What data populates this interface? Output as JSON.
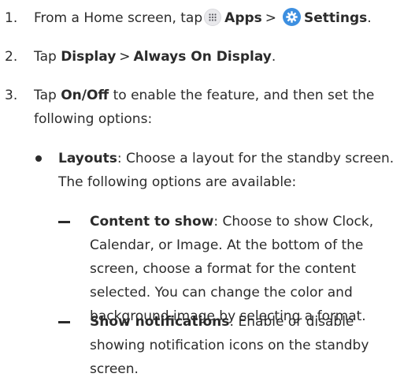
{
  "steps": [
    {
      "number": "1.",
      "prefix": "From a Home screen, tap",
      "apps_label": "Apps",
      "sep": ">",
      "settings_label": "Settings",
      "suffix": "."
    },
    {
      "number": "2.",
      "prefix": "Tap",
      "display_label": "Display",
      "sep": ">",
      "aod_label": "Always On Display",
      "suffix": "."
    },
    {
      "number": "3.",
      "prefix": "Tap",
      "onoff_label": "On/Off",
      "line1_rest": "to enable the feature, and then set the",
      "line2": "following options:"
    }
  ],
  "bullet": {
    "term": "Layouts",
    "line1_rest": ": Choose a layout for the standby screen.",
    "line2": "The following options are available:"
  },
  "sub_items": [
    {
      "term": "Content to show",
      "lines": [
        ": Choose to show Clock,",
        "Calendar, or Image. At the bottom of the",
        "screen, choose a format for the content",
        "selected. You can change the color and",
        "background image by selecting a format."
      ]
    },
    {
      "term": "Show notifications",
      "lines": [
        ": Enable or disable",
        "showing notification icons on the standby",
        "screen."
      ]
    }
  ],
  "icons": {
    "apps": "apps-grid-icon",
    "settings": "settings-gear-icon"
  },
  "colors": {
    "text": "#2b2b2b",
    "settings_icon_bg": "#3d8fe0",
    "apps_icon_bg": "#e9e9ec"
  }
}
